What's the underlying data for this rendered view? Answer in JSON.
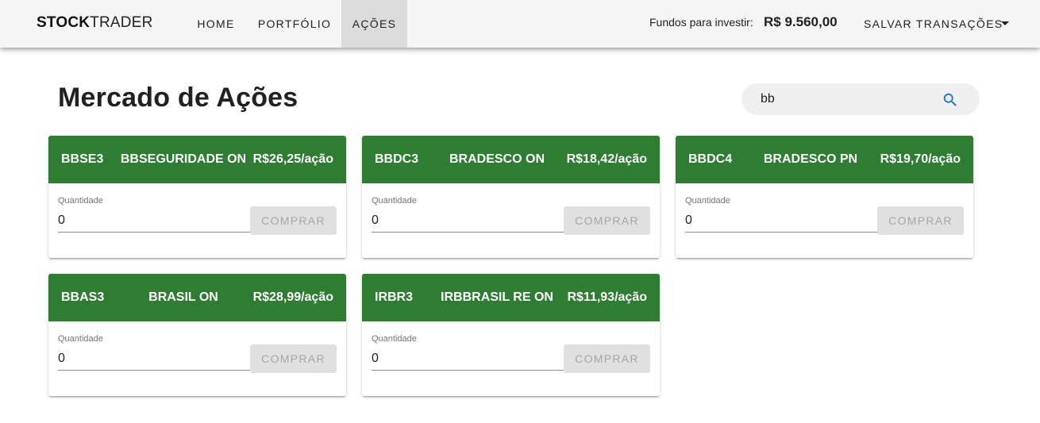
{
  "brand": {
    "bold": "STOCK",
    "light": "TRADER"
  },
  "nav": [
    {
      "label": "HOME",
      "active": false
    },
    {
      "label": "PORTFÓLIO",
      "active": false
    },
    {
      "label": "AÇÕES",
      "active": true
    }
  ],
  "funds": {
    "label": "Fundos para investir:",
    "value": "R$ 9.560,00"
  },
  "save_menu": {
    "label": "SALVAR TRANSAÇÕES",
    "icon": "caret-down-icon"
  },
  "page": {
    "title": "Mercado de Ações"
  },
  "search": {
    "value": "bb",
    "placeholder": "",
    "icon": "search-icon"
  },
  "colors": {
    "header_green": "#2e7d32",
    "accent_blue": "#1976d2",
    "navbar_bg": "#f5f5f5"
  },
  "stocks": [
    {
      "code": "BBSE3",
      "name": "BBSEGURIDADE ON",
      "price": "R$26,25/ação",
      "qty_label": "Quantidade",
      "qty": "0",
      "buy_label": "COMPRAR"
    },
    {
      "code": "BBDC3",
      "name": "BRADESCO ON",
      "price": "R$18,42/ação",
      "qty_label": "Quantidade",
      "qty": "0",
      "buy_label": "COMPRAR"
    },
    {
      "code": "BBDC4",
      "name": "BRADESCO PN",
      "price": "R$19,70/ação",
      "qty_label": "Quantidade",
      "qty": "0",
      "buy_label": "COMPRAR"
    },
    {
      "code": "BBAS3",
      "name": "BRASIL ON",
      "price": "R$28,99/ação",
      "qty_label": "Quantidade",
      "qty": "0",
      "buy_label": "COMPRAR"
    },
    {
      "code": "IRBR3",
      "name": "IRBBRASIL RE ON",
      "price": "R$11,93/ação",
      "qty_label": "Quantidade",
      "qty": "0",
      "buy_label": "COMPRAR"
    }
  ]
}
